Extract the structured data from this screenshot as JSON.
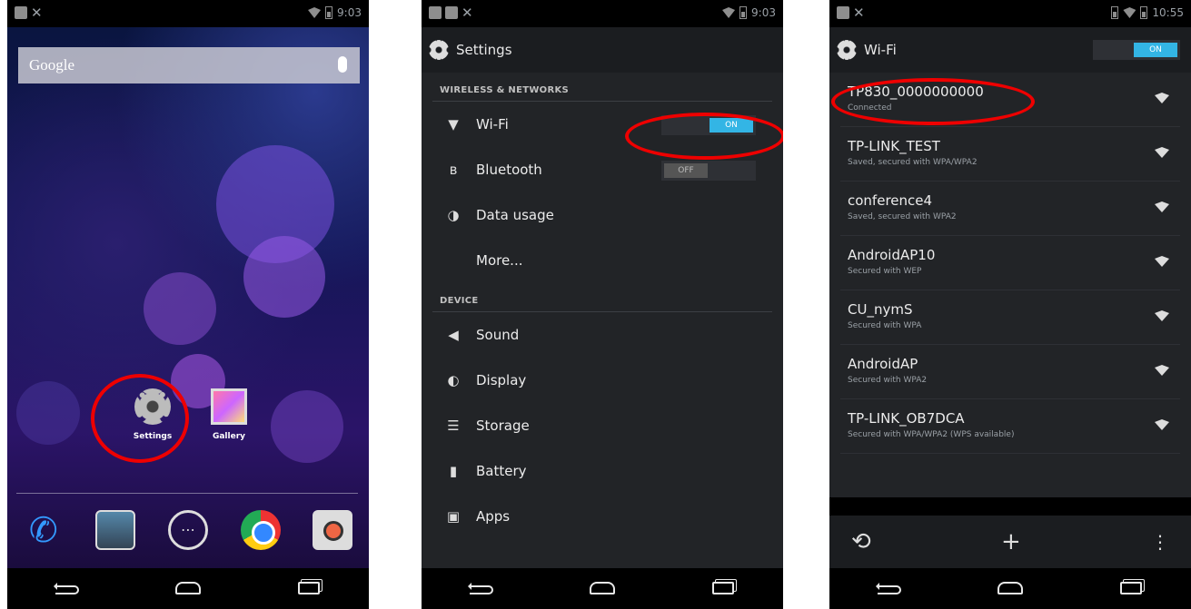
{
  "colors": {
    "highlight": "#ee0000",
    "toggle_on": "#33b5e5",
    "settings_bg": "#222427"
  },
  "phone1": {
    "status": {
      "time": "9:03"
    },
    "search": {
      "label": "Google"
    },
    "apps": [
      {
        "label": "Settings"
      },
      {
        "label": "Gallery"
      }
    ],
    "dock_icons": [
      "phone-icon",
      "people-icon",
      "apps-icon",
      "chrome-icon",
      "camera-icon"
    ]
  },
  "phone2": {
    "status": {
      "time": "9:03"
    },
    "title": "Settings",
    "sections": {
      "wireless": "WIRELESS & NETWORKS",
      "device": "DEVICE"
    },
    "items": [
      {
        "label": "Wi-Fi",
        "toggle": "ON"
      },
      {
        "label": "Bluetooth",
        "toggle": "OFF"
      },
      {
        "label": "Data usage"
      },
      {
        "label": "More..."
      },
      {
        "label": "Sound"
      },
      {
        "label": "Display"
      },
      {
        "label": "Storage"
      },
      {
        "label": "Battery"
      },
      {
        "label": "Apps"
      }
    ]
  },
  "phone3": {
    "status": {
      "time": "10:55"
    },
    "title": "Wi-Fi",
    "toggle": "ON",
    "networks": [
      {
        "ssid": "TP830_0000000000",
        "status": "Connected"
      },
      {
        "ssid": "TP-LINK_TEST",
        "status": "Saved, secured with WPA/WPA2"
      },
      {
        "ssid": "conference4",
        "status": "Saved, secured with WPA2"
      },
      {
        "ssid": "AndroidAP10",
        "status": "Secured with WEP"
      },
      {
        "ssid": "CU_nymS",
        "status": "Secured with WPA"
      },
      {
        "ssid": "AndroidAP",
        "status": "Secured with WPA2"
      },
      {
        "ssid": "TP-LINK_OB7DCA",
        "status": "Secured with WPA/WPA2 (WPS available)"
      }
    ]
  }
}
